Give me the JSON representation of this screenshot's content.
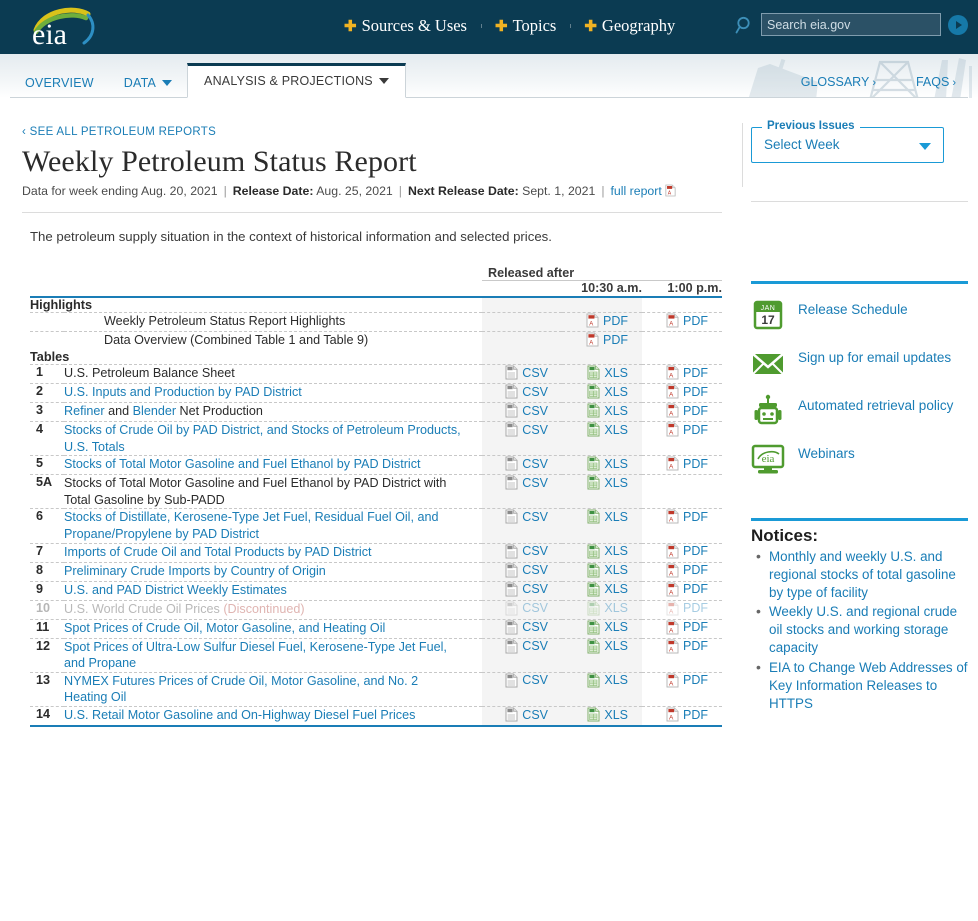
{
  "header": {
    "logo_alt": "eia",
    "nav": [
      {
        "label": "Sources & Uses"
      },
      {
        "label": "Topics"
      },
      {
        "label": "Geography"
      }
    ],
    "search_placeholder": "Search eia.gov",
    "search_value": ""
  },
  "tabs": {
    "items": [
      {
        "label": "OVERVIEW",
        "has_caret": false,
        "active": false
      },
      {
        "label": "DATA",
        "has_caret": true,
        "active": false
      },
      {
        "label": "ANALYSIS & PROJECTIONS",
        "has_caret": true,
        "active": true
      }
    ],
    "right_links": [
      {
        "label": "GLOSSARY",
        "chevron": "›"
      },
      {
        "label": "FAQS",
        "chevron": "›"
      }
    ]
  },
  "report": {
    "breadcrumb": "‹ SEE ALL PETROLEUM REPORTS",
    "title": "Weekly Petroleum Status Report",
    "meta_week_label": "Data for week ending",
    "meta_week_value": "Aug. 20, 2021",
    "meta_release_label": "Release Date:",
    "meta_release_value": "Aug. 25, 2021",
    "meta_next_label": "Next Release Date:",
    "meta_next_value": "Sept. 1, 2021",
    "meta_full_report": "full report",
    "intro": "The petroleum supply situation in the context of historical information and selected prices."
  },
  "table": {
    "released_after": "Released after",
    "time_1030": "10:30 a.m.",
    "time_100": "1:00 p.m.",
    "section_highlights": "Highlights",
    "section_tables": "Tables",
    "highlights": [
      {
        "title": "Weekly Petroleum Status Report Highlights",
        "col_a": "",
        "col_b": "PDF",
        "col_c": "PDF",
        "icon_a": "",
        "icon_b": "pdf-icon",
        "icon_c": "pdf-icon"
      },
      {
        "title": "Data Overview (Combined Table 1 and Table 9)",
        "col_a": "",
        "col_b": "PDF",
        "col_c": "",
        "icon_a": "",
        "icon_b": "pdf-icon",
        "icon_c": ""
      }
    ],
    "rows": [
      {
        "num": "1",
        "title": "U.S. Petroleum Balance Sheet",
        "link": false,
        "col_a": "CSV",
        "col_b": "XLS",
        "col_c": "PDF",
        "disabled": false
      },
      {
        "num": "2",
        "title": "U.S. Inputs and Production by PAD District",
        "link": true,
        "col_a": "CSV",
        "col_b": "XLS",
        "col_c": "PDF",
        "disabled": false
      },
      {
        "num": "3",
        "title": "Refiner and Blender Net Production",
        "link": "mixed",
        "col_a": "CSV",
        "col_b": "XLS",
        "col_c": "PDF",
        "disabled": false
      },
      {
        "num": "4",
        "title": "Stocks of Crude Oil by PAD District, and Stocks of Petroleum Products, U.S. Totals",
        "link": true,
        "col_a": "CSV",
        "col_b": "XLS",
        "col_c": "PDF",
        "disabled": false
      },
      {
        "num": "5",
        "title": "Stocks of Total Motor Gasoline and Fuel Ethanol by PAD District",
        "link": true,
        "col_a": "CSV",
        "col_b": "XLS",
        "col_c": "PDF",
        "disabled": false
      },
      {
        "num": "5A",
        "title": "Stocks of Total Motor Gasoline and Fuel Ethanol by PAD District with Total Gasoline by Sub-PADD",
        "link": false,
        "col_a": "CSV",
        "col_b": "XLS",
        "col_c": "",
        "disabled": false
      },
      {
        "num": "6",
        "title": "Stocks of Distillate, Kerosene-Type Jet Fuel, Residual Fuel Oil, and Propane/Propylene by PAD District",
        "link": true,
        "col_a": "CSV",
        "col_b": "XLS",
        "col_c": "PDF",
        "disabled": false
      },
      {
        "num": "7",
        "title": "Imports of Crude Oil and Total Products by PAD District",
        "link": true,
        "col_a": "CSV",
        "col_b": "XLS",
        "col_c": "PDF",
        "disabled": false
      },
      {
        "num": "8",
        "title": "Preliminary Crude Imports by Country of Origin",
        "link": true,
        "col_a": "CSV",
        "col_b": "XLS",
        "col_c": "PDF",
        "disabled": false
      },
      {
        "num": "9",
        "title": "U.S. and PAD District Weekly Estimates",
        "link": true,
        "col_a": "CSV",
        "col_b": "XLS",
        "col_c": "PDF",
        "disabled": false
      },
      {
        "num": "10",
        "title": "U.S. World Crude Oil Prices",
        "suffix": "(Discontinued)",
        "link": true,
        "col_a": "CSV",
        "col_b": "XLS",
        "col_c": "PDF",
        "disabled": true
      },
      {
        "num": "11",
        "title": "Spot Prices of Crude Oil, Motor Gasoline, and Heating Oil",
        "link": true,
        "col_a": "CSV",
        "col_b": "XLS",
        "col_c": "PDF",
        "disabled": false
      },
      {
        "num": "12",
        "title": "Spot Prices of Ultra-Low Sulfur Diesel Fuel, Kerosene-Type Jet Fuel, and Propane",
        "link": true,
        "col_a": "CSV",
        "col_b": "XLS",
        "col_c": "PDF",
        "disabled": false
      },
      {
        "num": "13",
        "title": "NYMEX Futures Prices of Crude Oil, Motor Gasoline, and No. 2 Heating Oil",
        "link": true,
        "col_a": "CSV",
        "col_b": "XLS",
        "col_c": "PDF",
        "disabled": false
      },
      {
        "num": "14",
        "title": "U.S. Retail Motor Gasoline and On-Highway Diesel Fuel Prices",
        "link": true,
        "col_a": "CSV",
        "col_b": "XLS",
        "col_c": "PDF",
        "disabled": false
      }
    ]
  },
  "sidebar": {
    "previous_issues_legend": "Previous Issues",
    "previous_issues_value": "Select Week",
    "links": [
      {
        "label": "Release Schedule",
        "icon": "calendar-icon",
        "cal_month": "JAN",
        "cal_day": "17"
      },
      {
        "label": "Sign up for email updates",
        "icon": "envelope-icon"
      },
      {
        "label": "Automated retrieval policy",
        "icon": "robot-icon"
      },
      {
        "label": "Webinars",
        "icon": "monitor-icon"
      }
    ],
    "notices_title": "Notices:",
    "notices": [
      "Monthly and weekly U.S. and regional stocks of total gasoline by type of facility",
      "Weekly U.S. and regional crude oil stocks and working storage capacity",
      "EIA to Change Web Addresses of Key Information Releases to HTTPS"
    ]
  },
  "colors": {
    "brand_dark": "#0b3b52",
    "link_blue": "#1a7db6",
    "accent_blue": "#1a9ad6",
    "accent_yellow": "#f0b323",
    "green": "#4f9b2f",
    "red": "#c1554f"
  }
}
